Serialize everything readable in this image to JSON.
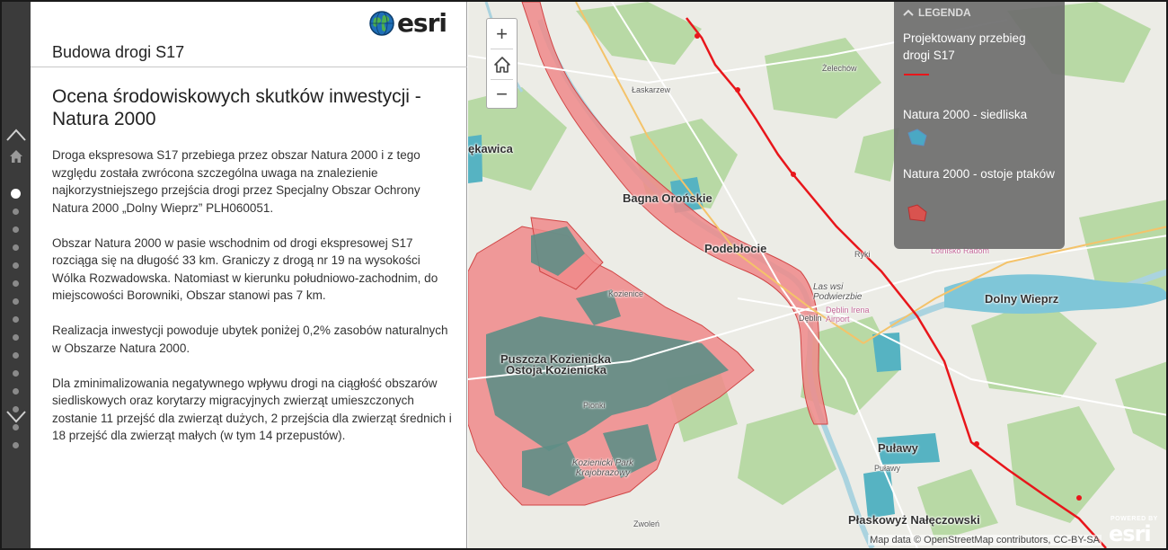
{
  "header": {
    "logo_text": "esri",
    "app_title": "Budowa drogi S17"
  },
  "section": {
    "heading": "Ocena środowiskowych skutków inwestycji - Natura 2000",
    "paragraphs": [
      "Droga ekspresowa S17 przebiega przez obszar Natura 2000 i z tego względu została zwrócona szczególna uwaga na znalezienie najkorzystniejszego przejścia drogi przez Specjalny Obszar Ochrony Natura 2000 „Dolny Wieprz” PLH060051.",
      "Obszar Natura 2000 w pasie wschodnim od drogi ekspresowej S17 rozciąga się na długość 33 km. Graniczy z drogą nr 19 na wysokości Wólka Rozwadowska. Natomiast w kierunku południowo-zachodnim, do miejscowości Borowniki, Obszar stanowi pas 7 km.",
      "Realizacja inwestycji powoduje ubytek poniżej 0,2% zasobów naturalnych w Obszarze Natura 2000.",
      "Dla zminimalizowania negatywnego wpływu drogi na ciągłość obszarów siedliskowych oraz korytarzy migracyjnych zwierząt umieszczonych zostanie 11 przejść dla zwierząt dużych, 2 przejścia dla zwierząt średnich i 18 przejść dla zwierząt małych (w tym 14 przepustów)."
    ]
  },
  "nav": {
    "dot_count": 15,
    "active_index": 0
  },
  "map": {
    "zoom_in_label": "+",
    "zoom_out_label": "−",
    "legend": {
      "title": "LEGENDA",
      "items": [
        {
          "label": "Projektowany przebieg drogi S17",
          "color": "#e8161b",
          "kind": "line"
        },
        {
          "label": "Natura 2000 - siedliska",
          "color": "#4aa8c4",
          "kind": "habitat"
        },
        {
          "label": "Natura 2000 - ostoje ptaków",
          "color": "#d9534f",
          "kind": "birds"
        }
      ]
    },
    "labels": {
      "bagna": "Bagna Orońskie",
      "podeblocie": "Podebłocie",
      "dolny_wieprz": "Dolny Wieprz",
      "pulawy_area": "Puławy",
      "pulawy_town": "Puławy",
      "puszcza": "Puszcza Kozienicka",
      "ostoja": "Ostoja Kozienicka",
      "plaskowyz": "Płaskowyż Nałęczowski",
      "wekawica": "ękawica",
      "zelechow": "Żelechów",
      "laskarzew": "Łaskarzew",
      "kozienice": "Kozienice",
      "ryki": "Ryki",
      "deblin": "Dęblin",
      "las_podwierzbie": "Las wsi Podwierzbie",
      "deblin_airport": "Dęblin Irena Airport",
      "park": "Kozienicki Park Krajobrazowy",
      "pionki": "Pionki",
      "zwolen": "Zwoleń",
      "lotnisko": "Lotnisko Radom"
    },
    "attribution": "Map data © OpenStreetMap contributors, CC-BY-SA",
    "powered_label": "POWERED BY",
    "powered_logo": "esri"
  },
  "colors": {
    "road": "#e8161b",
    "birds_fill": "#f08a8a",
    "habitat_fill": "#5e8e86",
    "water": "#aad3df",
    "forest": "#b8d9a5",
    "rail": "#3b3b3b"
  }
}
